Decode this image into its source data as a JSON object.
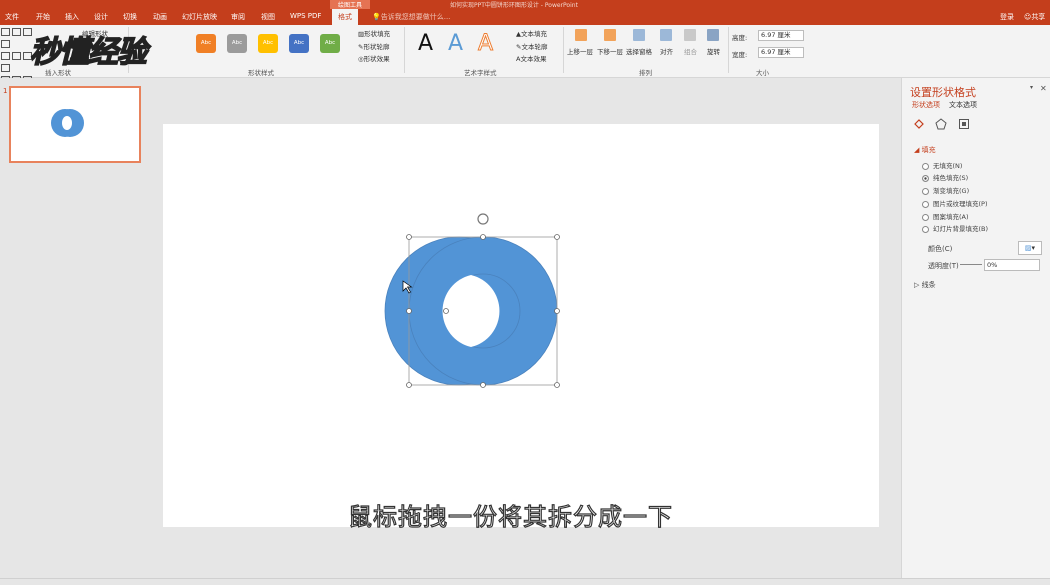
{
  "window": {
    "title": "如何实现PPT中圆饼形环图形设计 - PowerPoint",
    "context_tab_group": "绘图工具"
  },
  "tabs": [
    {
      "label": "文件"
    },
    {
      "label": "开始"
    },
    {
      "label": "插入"
    },
    {
      "label": "设计"
    },
    {
      "label": "切换"
    },
    {
      "label": "动画"
    },
    {
      "label": "幻灯片放映"
    },
    {
      "label": "审阅"
    },
    {
      "label": "视图"
    },
    {
      "label": "WPS PDF"
    },
    {
      "label": "格式"
    }
  ],
  "tell_me": "告诉我您想要做什么...",
  "account": {
    "login": "登录",
    "share": "共享"
  },
  "ribbon": {
    "edit_shape": "编辑形状",
    "group_insert_shapes": "插入形状",
    "group_shape_styles": "形状样式",
    "group_wordart_styles": "艺术字样式",
    "group_arrange": "排列",
    "group_size": "大小",
    "style_chips": [
      {
        "text": "Abc",
        "color": "#f07f25"
      },
      {
        "text": "Abc",
        "color": "#9b9b9b"
      },
      {
        "text": "Abc",
        "color": "#ffc000"
      },
      {
        "text": "Abc",
        "color": "#4472c4"
      },
      {
        "text": "Abc",
        "color": "#70ad47"
      }
    ],
    "shape_fill": "形状填充",
    "shape_outline": "形状轮廓",
    "shape_effects": "形状效果",
    "wordart_letter": "A",
    "text_fill": "文本填充",
    "text_outline": "文本轮廓",
    "text_effects": "文本效果",
    "arrange": [
      "上移一层",
      "下移一层",
      "选择窗格",
      "对齐",
      "组合",
      "旋转"
    ],
    "height_label": "高度:",
    "height_value": "6.97 厘米",
    "width_label": "宽度:",
    "width_value": "6.97 厘米"
  },
  "watermark": "秒懂经验",
  "slides": {
    "current_number": "1"
  },
  "caption": "鼠标拖拽一份将其拆分成一下",
  "shape_fill_color": "#5294d6",
  "format_pane": {
    "title": "设置形状格式",
    "tab_shape": "形状选项",
    "tab_text": "文本选项",
    "section_fill": "填充",
    "fill_options": [
      {
        "label": "无填充(N)",
        "selected": false
      },
      {
        "label": "纯色填充(S)",
        "selected": true
      },
      {
        "label": "渐变填充(G)",
        "selected": false
      },
      {
        "label": "图片或纹理填充(P)",
        "selected": false
      },
      {
        "label": "图案填充(A)",
        "selected": false
      },
      {
        "label": "幻灯片背景填充(B)",
        "selected": false
      }
    ],
    "color_label": "颜色(C)",
    "transparency_label": "透明度(T)",
    "transparency_value": "0%",
    "section_line": "线条"
  }
}
